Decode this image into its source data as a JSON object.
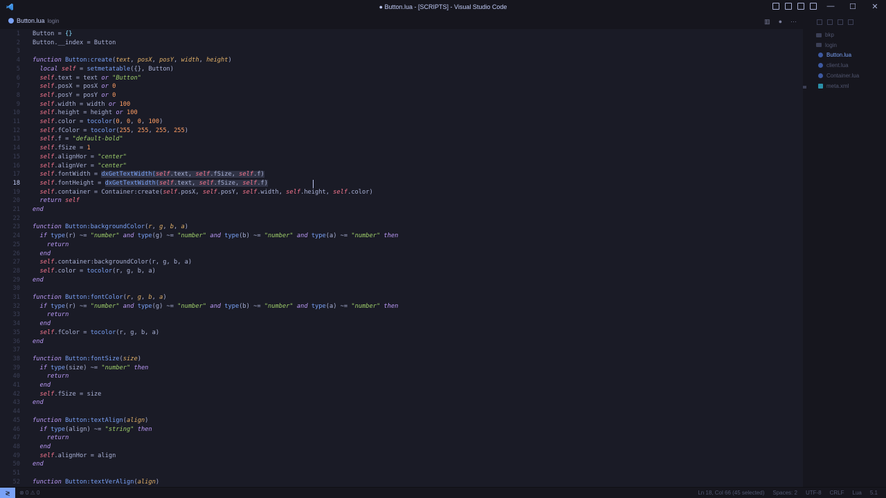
{
  "window": {
    "title": "● Button.lua - [SCRIPTS] - Visual Studio Code",
    "minimize": "—",
    "maximize": "☐",
    "close": "✕"
  },
  "tab": {
    "label": "Button.lua",
    "description": "login"
  },
  "editor_actions": [
    "▥",
    "●",
    "···"
  ],
  "active_line": 18,
  "code_lines": [
    [
      [
        "",
        "Button = "
      ],
      [
        "op",
        "{}"
      ]
    ],
    [
      [
        "",
        "Button.__index = Button"
      ]
    ],
    [],
    [
      [
        "kw",
        "function "
      ],
      [
        "fn",
        "Button:create"
      ],
      [
        "",
        "("
      ],
      [
        "param",
        "text"
      ],
      [
        "",
        ", "
      ],
      [
        "param",
        "posX"
      ],
      [
        "",
        ", "
      ],
      [
        "param",
        "posY"
      ],
      [
        "",
        ", "
      ],
      [
        "param",
        "width"
      ],
      [
        "",
        ", "
      ],
      [
        "param",
        "height"
      ],
      [
        "",
        ")"
      ]
    ],
    [
      [
        "",
        "  "
      ],
      [
        "kw",
        "local "
      ],
      [
        "self",
        "self"
      ],
      [
        "",
        " = "
      ],
      [
        "fn",
        "setmetatable"
      ],
      [
        "",
        "({}, Button)"
      ]
    ],
    [
      [
        "",
        "  "
      ],
      [
        "self",
        "self"
      ],
      [
        "",
        ".text = text "
      ],
      [
        "kw",
        "or "
      ],
      [
        "str",
        "\"Button\""
      ]
    ],
    [
      [
        "",
        "  "
      ],
      [
        "self",
        "self"
      ],
      [
        "",
        ".posX = posX "
      ],
      [
        "kw",
        "or "
      ],
      [
        "num",
        "0"
      ]
    ],
    [
      [
        "",
        "  "
      ],
      [
        "self",
        "self"
      ],
      [
        "",
        ".posY = posY "
      ],
      [
        "kw",
        "or "
      ],
      [
        "num",
        "0"
      ]
    ],
    [
      [
        "",
        "  "
      ],
      [
        "self",
        "self"
      ],
      [
        "",
        ".width = width "
      ],
      [
        "kw",
        "or "
      ],
      [
        "num",
        "100"
      ]
    ],
    [
      [
        "",
        "  "
      ],
      [
        "self",
        "self"
      ],
      [
        "",
        ".height = height "
      ],
      [
        "kw",
        "or "
      ],
      [
        "num",
        "100"
      ]
    ],
    [
      [
        "",
        "  "
      ],
      [
        "self",
        "self"
      ],
      [
        "",
        ".color = "
      ],
      [
        "fn",
        "tocolor"
      ],
      [
        "",
        "("
      ],
      [
        "num",
        "0"
      ],
      [
        "",
        ", "
      ],
      [
        "num",
        "0"
      ],
      [
        "",
        ", "
      ],
      [
        "num",
        "0"
      ],
      [
        "",
        ", "
      ],
      [
        "num",
        "100"
      ],
      [
        "",
        ")"
      ]
    ],
    [
      [
        "",
        "  "
      ],
      [
        "self",
        "self"
      ],
      [
        "",
        ".fColor = "
      ],
      [
        "fn",
        "tocolor"
      ],
      [
        "",
        "("
      ],
      [
        "num",
        "255"
      ],
      [
        "",
        ", "
      ],
      [
        "num",
        "255"
      ],
      [
        "",
        ", "
      ],
      [
        "num",
        "255"
      ],
      [
        "",
        ", "
      ],
      [
        "num",
        "255"
      ],
      [
        "",
        ")"
      ]
    ],
    [
      [
        "",
        "  "
      ],
      [
        "self",
        "self"
      ],
      [
        "",
        ".f = "
      ],
      [
        "str",
        "\"default-bold\""
      ]
    ],
    [
      [
        "",
        "  "
      ],
      [
        "self",
        "self"
      ],
      [
        "",
        ".fSize = "
      ],
      [
        "num",
        "1"
      ]
    ],
    [
      [
        "",
        "  "
      ],
      [
        "self",
        "self"
      ],
      [
        "",
        ".alignHor = "
      ],
      [
        "str",
        "\"center\""
      ]
    ],
    [
      [
        "",
        "  "
      ],
      [
        "self",
        "self"
      ],
      [
        "",
        ".alignVer = "
      ],
      [
        "str",
        "\"center\""
      ]
    ],
    [
      [
        "",
        "  "
      ],
      [
        "self",
        "self"
      ],
      [
        "",
        ".fontWidth = "
      ],
      [
        "fn hl",
        "dxGetTextWidth("
      ],
      [
        "self hl",
        "self"
      ],
      [
        "hl",
        ".text, "
      ],
      [
        "self hl",
        "self"
      ],
      [
        "hl",
        ".fSize, "
      ],
      [
        "self hl",
        "self"
      ],
      [
        "hl",
        ".f)"
      ]
    ],
    [
      [
        "",
        "  "
      ],
      [
        "self",
        "self"
      ],
      [
        "",
        ".fontHeight = "
      ],
      [
        "fn hl",
        "dxGetTextWidth("
      ],
      [
        "self hl",
        "self"
      ],
      [
        "hl",
        ".text, "
      ],
      [
        "self hl",
        "self"
      ],
      [
        "hl",
        ".fSize, "
      ],
      [
        "self hl",
        "self"
      ],
      [
        "hl",
        ".f)"
      ]
    ],
    [
      [
        "",
        "  "
      ],
      [
        "self",
        "self"
      ],
      [
        "",
        ".container = Container:create("
      ],
      [
        "self",
        "self"
      ],
      [
        "",
        ".posX, "
      ],
      [
        "self",
        "self"
      ],
      [
        "",
        ".posY, "
      ],
      [
        "self",
        "self"
      ],
      [
        "",
        ".width, "
      ],
      [
        "self",
        "self"
      ],
      [
        "",
        ".height, "
      ],
      [
        "self",
        "self"
      ],
      [
        "",
        ".color)"
      ]
    ],
    [
      [
        "",
        "  "
      ],
      [
        "kw",
        "return "
      ],
      [
        "self",
        "self"
      ]
    ],
    [
      [
        "kw",
        "end"
      ]
    ],
    [],
    [
      [
        "kw",
        "function "
      ],
      [
        "fn",
        "Button:backgroundColor"
      ],
      [
        "",
        "("
      ],
      [
        "param",
        "r"
      ],
      [
        "",
        ", "
      ],
      [
        "param",
        "g"
      ],
      [
        "",
        ", "
      ],
      [
        "param",
        "b"
      ],
      [
        "",
        ", "
      ],
      [
        "param",
        "a"
      ],
      [
        "",
        ")"
      ]
    ],
    [
      [
        "",
        "  "
      ],
      [
        "kw",
        "if "
      ],
      [
        "fn",
        "type"
      ],
      [
        "",
        "(r) ~= "
      ],
      [
        "str",
        "\"number\""
      ],
      [
        "kw",
        " and "
      ],
      [
        "fn",
        "type"
      ],
      [
        "",
        "(g) ~= "
      ],
      [
        "str",
        "\"number\""
      ],
      [
        "kw",
        " and "
      ],
      [
        "fn",
        "type"
      ],
      [
        "",
        "(b) ~= "
      ],
      [
        "str",
        "\"number\""
      ],
      [
        "kw",
        " and "
      ],
      [
        "fn",
        "type"
      ],
      [
        "",
        "(a) ~= "
      ],
      [
        "str",
        "\"number\""
      ],
      [
        "kw",
        " then"
      ]
    ],
    [
      [
        "",
        "    "
      ],
      [
        "kw",
        "return"
      ]
    ],
    [
      [
        "",
        "  "
      ],
      [
        "kw",
        "end"
      ]
    ],
    [
      [
        "",
        "  "
      ],
      [
        "self",
        "self"
      ],
      [
        "",
        ".container:backgroundColor(r, g, b, a)"
      ]
    ],
    [
      [
        "",
        "  "
      ],
      [
        "self",
        "self"
      ],
      [
        "",
        ".color = "
      ],
      [
        "fn",
        "tocolor"
      ],
      [
        "",
        "(r, g, b, a)"
      ]
    ],
    [
      [
        "kw",
        "end"
      ]
    ],
    [],
    [
      [
        "kw",
        "function "
      ],
      [
        "fn",
        "Button:fontColor"
      ],
      [
        "",
        "("
      ],
      [
        "param",
        "r"
      ],
      [
        "",
        ", "
      ],
      [
        "param",
        "g"
      ],
      [
        "",
        ", "
      ],
      [
        "param",
        "b"
      ],
      [
        "",
        ", "
      ],
      [
        "param",
        "a"
      ],
      [
        "",
        ")"
      ]
    ],
    [
      [
        "",
        "  "
      ],
      [
        "kw",
        "if "
      ],
      [
        "fn",
        "type"
      ],
      [
        "",
        "(r) ~= "
      ],
      [
        "str",
        "\"number\""
      ],
      [
        "kw",
        " and "
      ],
      [
        "fn",
        "type"
      ],
      [
        "",
        "(g) ~= "
      ],
      [
        "str",
        "\"number\""
      ],
      [
        "kw",
        " and "
      ],
      [
        "fn",
        "type"
      ],
      [
        "",
        "(b) ~= "
      ],
      [
        "str",
        "\"number\""
      ],
      [
        "kw",
        " and "
      ],
      [
        "fn",
        "type"
      ],
      [
        "",
        "(a) ~= "
      ],
      [
        "str",
        "\"number\""
      ],
      [
        "kw",
        " then"
      ]
    ],
    [
      [
        "",
        "    "
      ],
      [
        "kw",
        "return"
      ]
    ],
    [
      [
        "",
        "  "
      ],
      [
        "kw",
        "end"
      ]
    ],
    [
      [
        "",
        "  "
      ],
      [
        "self",
        "self"
      ],
      [
        "",
        ".fColor = "
      ],
      [
        "fn",
        "tocolor"
      ],
      [
        "",
        "(r, g, b, a)"
      ]
    ],
    [
      [
        "kw",
        "end"
      ]
    ],
    [],
    [
      [
        "kw",
        "function "
      ],
      [
        "fn",
        "Button:fontSize"
      ],
      [
        "",
        "("
      ],
      [
        "param",
        "size"
      ],
      [
        "",
        ")"
      ]
    ],
    [
      [
        "",
        "  "
      ],
      [
        "kw",
        "if "
      ],
      [
        "fn",
        "type"
      ],
      [
        "",
        "(size) ~= "
      ],
      [
        "str",
        "\"number\""
      ],
      [
        "kw",
        " then"
      ]
    ],
    [
      [
        "",
        "    "
      ],
      [
        "kw",
        "return"
      ]
    ],
    [
      [
        "",
        "  "
      ],
      [
        "kw",
        "end"
      ]
    ],
    [
      [
        "",
        "  "
      ],
      [
        "self",
        "self"
      ],
      [
        "",
        ".fSize = size"
      ]
    ],
    [
      [
        "kw",
        "end"
      ]
    ],
    [],
    [
      [
        "kw",
        "function "
      ],
      [
        "fn",
        "Button:textAlign"
      ],
      [
        "",
        "("
      ],
      [
        "param",
        "align"
      ],
      [
        "",
        ")"
      ]
    ],
    [
      [
        "",
        "  "
      ],
      [
        "kw",
        "if "
      ],
      [
        "fn",
        "type"
      ],
      [
        "",
        "(align) ~= "
      ],
      [
        "str",
        "\"string\""
      ],
      [
        "kw",
        " then"
      ]
    ],
    [
      [
        "",
        "    "
      ],
      [
        "kw",
        "return"
      ]
    ],
    [
      [
        "",
        "  "
      ],
      [
        "kw",
        "end"
      ]
    ],
    [
      [
        "",
        "  "
      ],
      [
        "self",
        "self"
      ],
      [
        "",
        ".alignHor = align"
      ]
    ],
    [
      [
        "kw",
        "end"
      ]
    ],
    [],
    [
      [
        "kw",
        "function "
      ],
      [
        "fn",
        "Button:textVerAlign"
      ],
      [
        "",
        "("
      ],
      [
        "param",
        "align"
      ],
      [
        "",
        ")"
      ]
    ]
  ],
  "explorer": {
    "items": [
      {
        "label": "bkp",
        "type": "folder",
        "active": false
      },
      {
        "label": "login",
        "type": "folder",
        "active": false
      },
      {
        "label": "Button.lua",
        "type": "lua",
        "active": true
      },
      {
        "label": "client.lua",
        "type": "lua",
        "active": false
      },
      {
        "label": "Container.lua",
        "type": "lua",
        "active": false
      },
      {
        "label": "meta.xml",
        "type": "xml",
        "active": false
      }
    ]
  },
  "statusbar": {
    "remote": "≷",
    "problems": "⊗ 0 ⚠ 0",
    "cursor": "Ln 18, Col 66 (45 selected)",
    "spaces": "Spaces: 2",
    "encoding": "UTF-8",
    "eol": "CRLF",
    "language": "Lua",
    "version": "5.1"
  }
}
